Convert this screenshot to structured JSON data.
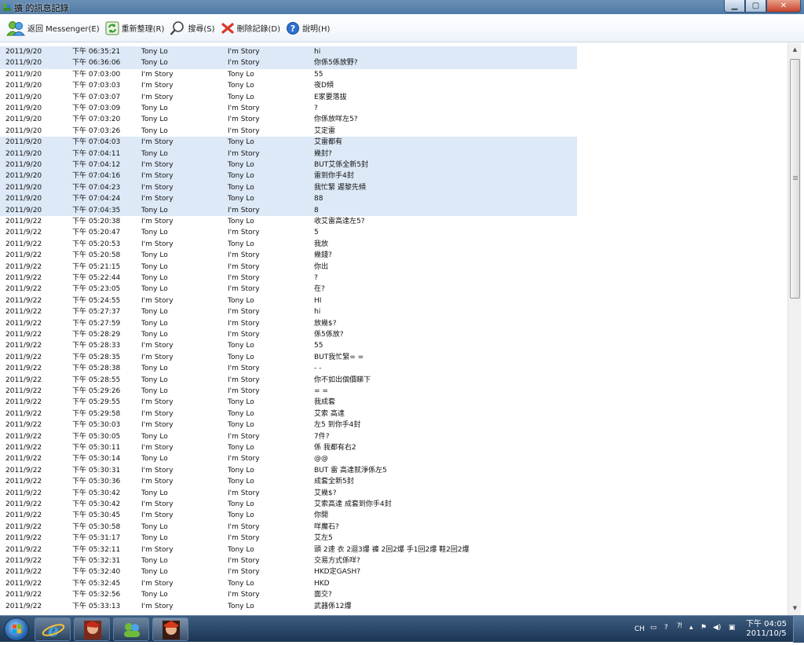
{
  "window": {
    "title": "擴 的訊息記錄"
  },
  "toolbar": {
    "back_label": "返回 Messenger(E)",
    "refresh_label": "重新整理(R)",
    "search_label": "搜尋(S)",
    "delete_label": "刪除記錄(D)",
    "help_label": "說明(H)"
  },
  "messages": [
    {
      "date": "2011/9/20",
      "time": "下午 06:35:21",
      "from": "Tony Lo",
      "to": "I'm Story",
      "text": "hi",
      "sel": true
    },
    {
      "date": "2011/9/20",
      "time": "下午 06:36:06",
      "from": "Tony Lo",
      "to": "I'm Story",
      "text": "你係5係放野?",
      "sel": true
    },
    {
      "date": "2011/9/20",
      "time": "下午 07:03:00",
      "from": "I'm Story",
      "to": "Tony Lo",
      "text": "55",
      "sel": false
    },
    {
      "date": "2011/9/20",
      "time": "下午 07:03:03",
      "from": "I'm Story",
      "to": "Tony Lo",
      "text": "夜D傾",
      "sel": false
    },
    {
      "date": "2011/9/20",
      "time": "下午 07:03:07",
      "from": "I'm Story",
      "to": "Tony Lo",
      "text": "E家要落拔",
      "sel": false
    },
    {
      "date": "2011/9/20",
      "time": "下午 07:03:09",
      "from": "Tony Lo",
      "to": "I'm Story",
      "text": "?",
      "sel": false
    },
    {
      "date": "2011/9/20",
      "time": "下午 07:03:20",
      "from": "Tony Lo",
      "to": "I'm Story",
      "text": "你係放咩左5?",
      "sel": false
    },
    {
      "date": "2011/9/20",
      "time": "下午 07:03:26",
      "from": "Tony Lo",
      "to": "I'm Story",
      "text": "艾定雷",
      "sel": false
    },
    {
      "date": "2011/9/20",
      "time": "下午 07:04:03",
      "from": "I'm Story",
      "to": "Tony Lo",
      "text": "艾雷都有",
      "sel": true
    },
    {
      "date": "2011/9/20",
      "time": "下午 07:04:11",
      "from": "Tony Lo",
      "to": "I'm Story",
      "text": "幾封?",
      "sel": true
    },
    {
      "date": "2011/9/20",
      "time": "下午 07:04:12",
      "from": "I'm Story",
      "to": "Tony Lo",
      "text": "BUT艾係全新5封",
      "sel": true
    },
    {
      "date": "2011/9/20",
      "time": "下午 07:04:16",
      "from": "I'm Story",
      "to": "Tony Lo",
      "text": "雷到你手4封",
      "sel": true
    },
    {
      "date": "2011/9/20",
      "time": "下午 07:04:23",
      "from": "I'm Story",
      "to": "Tony Lo",
      "text": "我忙緊 遲黎先傾",
      "sel": true
    },
    {
      "date": "2011/9/20",
      "time": "下午 07:04:24",
      "from": "I'm Story",
      "to": "Tony Lo",
      "text": "88",
      "sel": true
    },
    {
      "date": "2011/9/20",
      "time": "下午 07:04:35",
      "from": "Tony Lo",
      "to": "I'm Story",
      "text": "8",
      "sel": true
    },
    {
      "date": "2011/9/22",
      "time": "下午 05:20:38",
      "from": "I'm Story",
      "to": "Tony Lo",
      "text": "收艾雷高達左5?",
      "sel": false
    },
    {
      "date": "2011/9/22",
      "time": "下午 05:20:47",
      "from": "Tony Lo",
      "to": "I'm Story",
      "text": "5",
      "sel": false
    },
    {
      "date": "2011/9/22",
      "time": "下午 05:20:53",
      "from": "I'm Story",
      "to": "Tony Lo",
      "text": "我放",
      "sel": false
    },
    {
      "date": "2011/9/22",
      "time": "下午 05:20:58",
      "from": "Tony Lo",
      "to": "I'm Story",
      "text": "幾錢?",
      "sel": false
    },
    {
      "date": "2011/9/22",
      "time": "下午 05:21:15",
      "from": "Tony Lo",
      "to": "I'm Story",
      "text": "你出",
      "sel": false
    },
    {
      "date": "2011/9/22",
      "time": "下午 05:22:44",
      "from": "Tony Lo",
      "to": "I'm Story",
      "text": "?",
      "sel": false
    },
    {
      "date": "2011/9/22",
      "time": "下午 05:23:05",
      "from": "Tony Lo",
      "to": "I'm Story",
      "text": "在?",
      "sel": false
    },
    {
      "date": "2011/9/22",
      "time": "下午 05:24:55",
      "from": "I'm Story",
      "to": "Tony Lo",
      "text": "HI",
      "sel": false
    },
    {
      "date": "2011/9/22",
      "time": "下午 05:27:37",
      "from": "Tony Lo",
      "to": "I'm Story",
      "text": "hi",
      "sel": false
    },
    {
      "date": "2011/9/22",
      "time": "下午 05:27:59",
      "from": "Tony Lo",
      "to": "I'm Story",
      "text": "放幾$?",
      "sel": false
    },
    {
      "date": "2011/9/22",
      "time": "下午 05:28:29",
      "from": "Tony Lo",
      "to": "I'm Story",
      "text": "係5係放?",
      "sel": false
    },
    {
      "date": "2011/9/22",
      "time": "下午 05:28:33",
      "from": "I'm Story",
      "to": "Tony Lo",
      "text": "55",
      "sel": false
    },
    {
      "date": "2011/9/22",
      "time": "下午 05:28:35",
      "from": "I'm Story",
      "to": "Tony Lo",
      "text": "BUT我忙緊= =",
      "sel": false
    },
    {
      "date": "2011/9/22",
      "time": "下午 05:28:38",
      "from": "Tony Lo",
      "to": "I'm Story",
      "text": "- -",
      "sel": false
    },
    {
      "date": "2011/9/22",
      "time": "下午 05:28:55",
      "from": "Tony Lo",
      "to": "I'm Story",
      "text": "你不如出個價睇下",
      "sel": false
    },
    {
      "date": "2011/9/22",
      "time": "下午 05:29:26",
      "from": "Tony Lo",
      "to": "I'm Story",
      "text": "= =",
      "sel": false
    },
    {
      "date": "2011/9/22",
      "time": "下午 05:29:55",
      "from": "I'm Story",
      "to": "Tony Lo",
      "text": "我成套",
      "sel": false
    },
    {
      "date": "2011/9/22",
      "time": "下午 05:29:58",
      "from": "I'm Story",
      "to": "Tony Lo",
      "text": "艾索 高達",
      "sel": false
    },
    {
      "date": "2011/9/22",
      "time": "下午 05:30:03",
      "from": "I'm Story",
      "to": "Tony Lo",
      "text": "左5 到你手4封",
      "sel": false
    },
    {
      "date": "2011/9/22",
      "time": "下午 05:30:05",
      "from": "Tony Lo",
      "to": "I'm Story",
      "text": "7件?",
      "sel": false
    },
    {
      "date": "2011/9/22",
      "time": "下午 05:30:11",
      "from": "I'm Story",
      "to": "Tony Lo",
      "text": "係 我都有右2",
      "sel": false
    },
    {
      "date": "2011/9/22",
      "time": "下午 05:30:14",
      "from": "Tony Lo",
      "to": "I'm Story",
      "text": "@@",
      "sel": false
    },
    {
      "date": "2011/9/22",
      "time": "下午 05:30:31",
      "from": "I'm Story",
      "to": "Tony Lo",
      "text": "BUT 雷 高達就淨係左5",
      "sel": false
    },
    {
      "date": "2011/9/22",
      "time": "下午 05:30:36",
      "from": "I'm Story",
      "to": "Tony Lo",
      "text": "成套全新5封",
      "sel": false
    },
    {
      "date": "2011/9/22",
      "time": "下午 05:30:42",
      "from": "Tony Lo",
      "to": "I'm Story",
      "text": "艾幾$?",
      "sel": false
    },
    {
      "date": "2011/9/22",
      "time": "下午 05:30:42",
      "from": "I'm Story",
      "to": "Tony Lo",
      "text": "艾索高達 成套到你手4封",
      "sel": false
    },
    {
      "date": "2011/9/22",
      "time": "下午 05:30:45",
      "from": "I'm Story",
      "to": "Tony Lo",
      "text": "你開",
      "sel": false
    },
    {
      "date": "2011/9/22",
      "time": "下午 05:30:58",
      "from": "Tony Lo",
      "to": "I'm Story",
      "text": "咩魔石?",
      "sel": false
    },
    {
      "date": "2011/9/22",
      "time": "下午 05:31:17",
      "from": "Tony Lo",
      "to": "I'm Story",
      "text": "艾左5",
      "sel": false
    },
    {
      "date": "2011/9/22",
      "time": "下午 05:32:11",
      "from": "I'm Story",
      "to": "Tony Lo",
      "text": "頭 2速 衣 2迴3爆 褲 2回2爆 手1回2爆 鞋2回2爆",
      "sel": false
    },
    {
      "date": "2011/9/22",
      "time": "下午 05:32:31",
      "from": "Tony Lo",
      "to": "I'm Story",
      "text": "交易方式係咩?",
      "sel": false
    },
    {
      "date": "2011/9/22",
      "time": "下午 05:32:40",
      "from": "Tony Lo",
      "to": "I'm Story",
      "text": "HKD定GASH?",
      "sel": false
    },
    {
      "date": "2011/9/22",
      "time": "下午 05:32:45",
      "from": "I'm Story",
      "to": "Tony Lo",
      "text": "HKD",
      "sel": false
    },
    {
      "date": "2011/9/22",
      "time": "下午 05:32:56",
      "from": "Tony Lo",
      "to": "I'm Story",
      "text": "面交?",
      "sel": false
    },
    {
      "date": "2011/9/22",
      "time": "下午 05:33:13",
      "from": "I'm Story",
      "to": "Tony Lo",
      "text": "武器係12爆",
      "sel": false
    }
  ],
  "tray": {
    "lang": "CH",
    "time": "下午 04:05",
    "date": "2011/10/5"
  }
}
